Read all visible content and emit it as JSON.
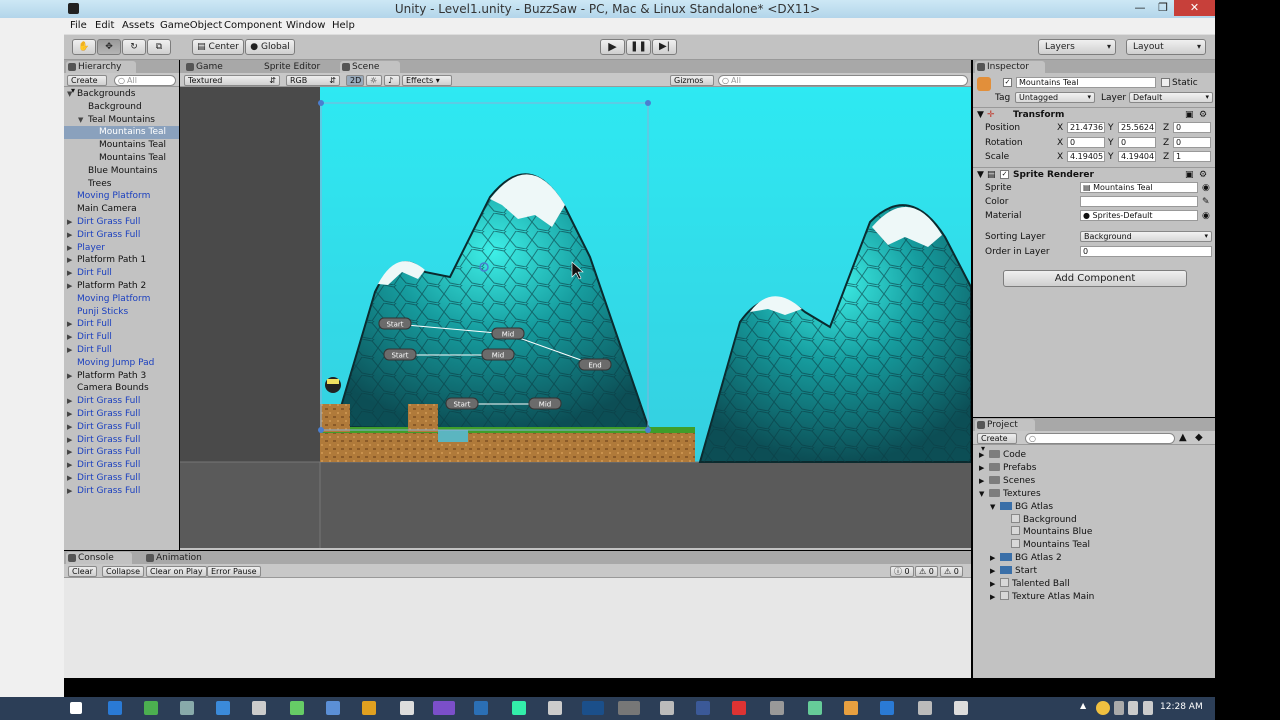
{
  "window": {
    "title": "Unity - Level1.unity - BuzzSaw - PC, Mac & Linux Standalone* <DX11>"
  },
  "menu": [
    "File",
    "Edit",
    "Assets",
    "GameObject",
    "Component",
    "Window",
    "Help"
  ],
  "toolbar": {
    "pivot": "Center",
    "space": "Global",
    "layers": "Layers",
    "layout": "Layout"
  },
  "hierarchy": {
    "tab": "Hierarchy",
    "create": "Create",
    "search": "All",
    "items": [
      {
        "label": "Backgrounds",
        "indent": 0,
        "arrow": "open",
        "prefab": false,
        "selected": false
      },
      {
        "label": "Background",
        "indent": 1,
        "arrow": "",
        "prefab": false,
        "selected": false
      },
      {
        "label": "Teal Mountains",
        "indent": 1,
        "arrow": "open",
        "prefab": false,
        "selected": false
      },
      {
        "label": "Mountains Teal",
        "indent": 2,
        "arrow": "",
        "prefab": false,
        "selected": true
      },
      {
        "label": "Mountains Teal",
        "indent": 2,
        "arrow": "",
        "prefab": false,
        "selected": false
      },
      {
        "label": "Mountains Teal",
        "indent": 2,
        "arrow": "",
        "prefab": false,
        "selected": false
      },
      {
        "label": "Blue Mountains",
        "indent": 1,
        "arrow": "",
        "prefab": false,
        "selected": false
      },
      {
        "label": "Trees",
        "indent": 1,
        "arrow": "",
        "prefab": false,
        "selected": false
      },
      {
        "label": "Moving Platform",
        "indent": 0,
        "arrow": "",
        "prefab": true,
        "selected": false
      },
      {
        "label": "Main Camera",
        "indent": 0,
        "arrow": "",
        "prefab": false,
        "selected": false
      },
      {
        "label": "Dirt Grass Full",
        "indent": 0,
        "arrow": "closed",
        "prefab": true,
        "selected": false
      },
      {
        "label": "Dirt Grass Full",
        "indent": 0,
        "arrow": "closed",
        "prefab": true,
        "selected": false
      },
      {
        "label": "Player",
        "indent": 0,
        "arrow": "closed",
        "prefab": true,
        "selected": false
      },
      {
        "label": "Platform Path 1",
        "indent": 0,
        "arrow": "closed",
        "prefab": false,
        "selected": false
      },
      {
        "label": "Dirt Full",
        "indent": 0,
        "arrow": "closed",
        "prefab": true,
        "selected": false
      },
      {
        "label": "Platform Path 2",
        "indent": 0,
        "arrow": "closed",
        "prefab": false,
        "selected": false
      },
      {
        "label": "Moving Platform",
        "indent": 0,
        "arrow": "",
        "prefab": true,
        "selected": false
      },
      {
        "label": "Punji Sticks",
        "indent": 0,
        "arrow": "",
        "prefab": true,
        "selected": false
      },
      {
        "label": "Dirt Full",
        "indent": 0,
        "arrow": "closed",
        "prefab": true,
        "selected": false
      },
      {
        "label": "Dirt Full",
        "indent": 0,
        "arrow": "closed",
        "prefab": true,
        "selected": false
      },
      {
        "label": "Dirt Full",
        "indent": 0,
        "arrow": "closed",
        "prefab": true,
        "selected": false
      },
      {
        "label": "Moving Jump Pad",
        "indent": 0,
        "arrow": "",
        "prefab": true,
        "selected": false
      },
      {
        "label": "Platform Path 3",
        "indent": 0,
        "arrow": "closed",
        "prefab": false,
        "selected": false
      },
      {
        "label": "Camera Bounds",
        "indent": 0,
        "arrow": "",
        "prefab": false,
        "selected": false
      },
      {
        "label": "Dirt Grass Full",
        "indent": 0,
        "arrow": "closed",
        "prefab": true,
        "selected": false
      },
      {
        "label": "Dirt Grass Full",
        "indent": 0,
        "arrow": "closed",
        "prefab": true,
        "selected": false
      },
      {
        "label": "Dirt Grass Full",
        "indent": 0,
        "arrow": "closed",
        "prefab": true,
        "selected": false
      },
      {
        "label": "Dirt Grass Full",
        "indent": 0,
        "arrow": "closed",
        "prefab": true,
        "selected": false
      },
      {
        "label": "Dirt Grass Full",
        "indent": 0,
        "arrow": "closed",
        "prefab": true,
        "selected": false
      },
      {
        "label": "Dirt Grass Full",
        "indent": 0,
        "arrow": "closed",
        "prefab": true,
        "selected": false
      },
      {
        "label": "Dirt Grass Full",
        "indent": 0,
        "arrow": "closed",
        "prefab": true,
        "selected": false
      },
      {
        "label": "Dirt Grass Full",
        "indent": 0,
        "arrow": "closed",
        "prefab": true,
        "selected": false
      }
    ]
  },
  "scene": {
    "tabs": [
      "Game",
      "Sprite Editor",
      "Scene"
    ],
    "shading": "Textured",
    "color": "RGB",
    "mode2d": "2D",
    "effects": "Effects",
    "gizmos": "Gizmos",
    "search": "All",
    "path_nodes": [
      {
        "label": "Start"
      },
      {
        "label": "Mid"
      },
      {
        "label": "End"
      },
      {
        "label": "Start"
      },
      {
        "label": "Mid"
      },
      {
        "label": "Start"
      },
      {
        "label": "Mid"
      }
    ]
  },
  "console": {
    "tabs": [
      "Console",
      "Animation"
    ],
    "buttons": [
      "Clear",
      "Collapse",
      "Clear on Play",
      "Error Pause"
    ],
    "counts": [
      "0",
      "0",
      "0"
    ]
  },
  "inspector": {
    "tab": "Inspector",
    "name": "Mountains Teal",
    "static_label": "Static",
    "tag_label": "Tag",
    "tag": "Untagged",
    "layer_label": "Layer",
    "layer": "Default",
    "transform": {
      "title": "Transform",
      "rows": [
        {
          "label": "Position",
          "x": "21.4736",
          "y": "25.5624",
          "z": "0"
        },
        {
          "label": "Rotation",
          "x": "0",
          "y": "0",
          "z": "0"
        },
        {
          "label": "Scale",
          "x": "4.19405",
          "y": "4.19404",
          "z": "1"
        }
      ]
    },
    "sprite_renderer": {
      "title": "Sprite Renderer",
      "sprite_label": "Sprite",
      "sprite": "Mountains Teal",
      "color_label": "Color",
      "material_label": "Material",
      "material": "Sprites-Default",
      "sorting_label": "Sorting Layer",
      "sorting": "Background",
      "order_label": "Order in Layer",
      "order": "0"
    },
    "add_component": "Add Component"
  },
  "project": {
    "tab": "Project",
    "create": "Create",
    "items": [
      {
        "label": "Code",
        "icon": "folder",
        "arrow": "closed",
        "indent": 0
      },
      {
        "label": "Prefabs",
        "icon": "folder",
        "arrow": "closed",
        "indent": 0
      },
      {
        "label": "Scenes",
        "icon": "folder",
        "arrow": "closed",
        "indent": 0
      },
      {
        "label": "Textures",
        "icon": "folder",
        "arrow": "open",
        "indent": 0
      },
      {
        "label": "BG Atlas",
        "icon": "atlas",
        "arrow": "open",
        "indent": 1
      },
      {
        "label": "Background",
        "icon": "file",
        "arrow": "",
        "indent": 2
      },
      {
        "label": "Mountains Blue",
        "icon": "file",
        "arrow": "",
        "indent": 2
      },
      {
        "label": "Mountains Teal",
        "icon": "file",
        "arrow": "",
        "indent": 2
      },
      {
        "label": "BG Atlas 2",
        "icon": "atlas",
        "arrow": "closed",
        "indent": 1
      },
      {
        "label": "Start",
        "icon": "atlas",
        "arrow": "closed",
        "indent": 1
      },
      {
        "label": "Talented Ball",
        "icon": "file",
        "arrow": "closed",
        "indent": 1
      },
      {
        "label": "Texture Atlas Main",
        "icon": "file",
        "arrow": "closed",
        "indent": 1
      }
    ]
  },
  "taskbar": {
    "clock": "12:28 AM"
  }
}
